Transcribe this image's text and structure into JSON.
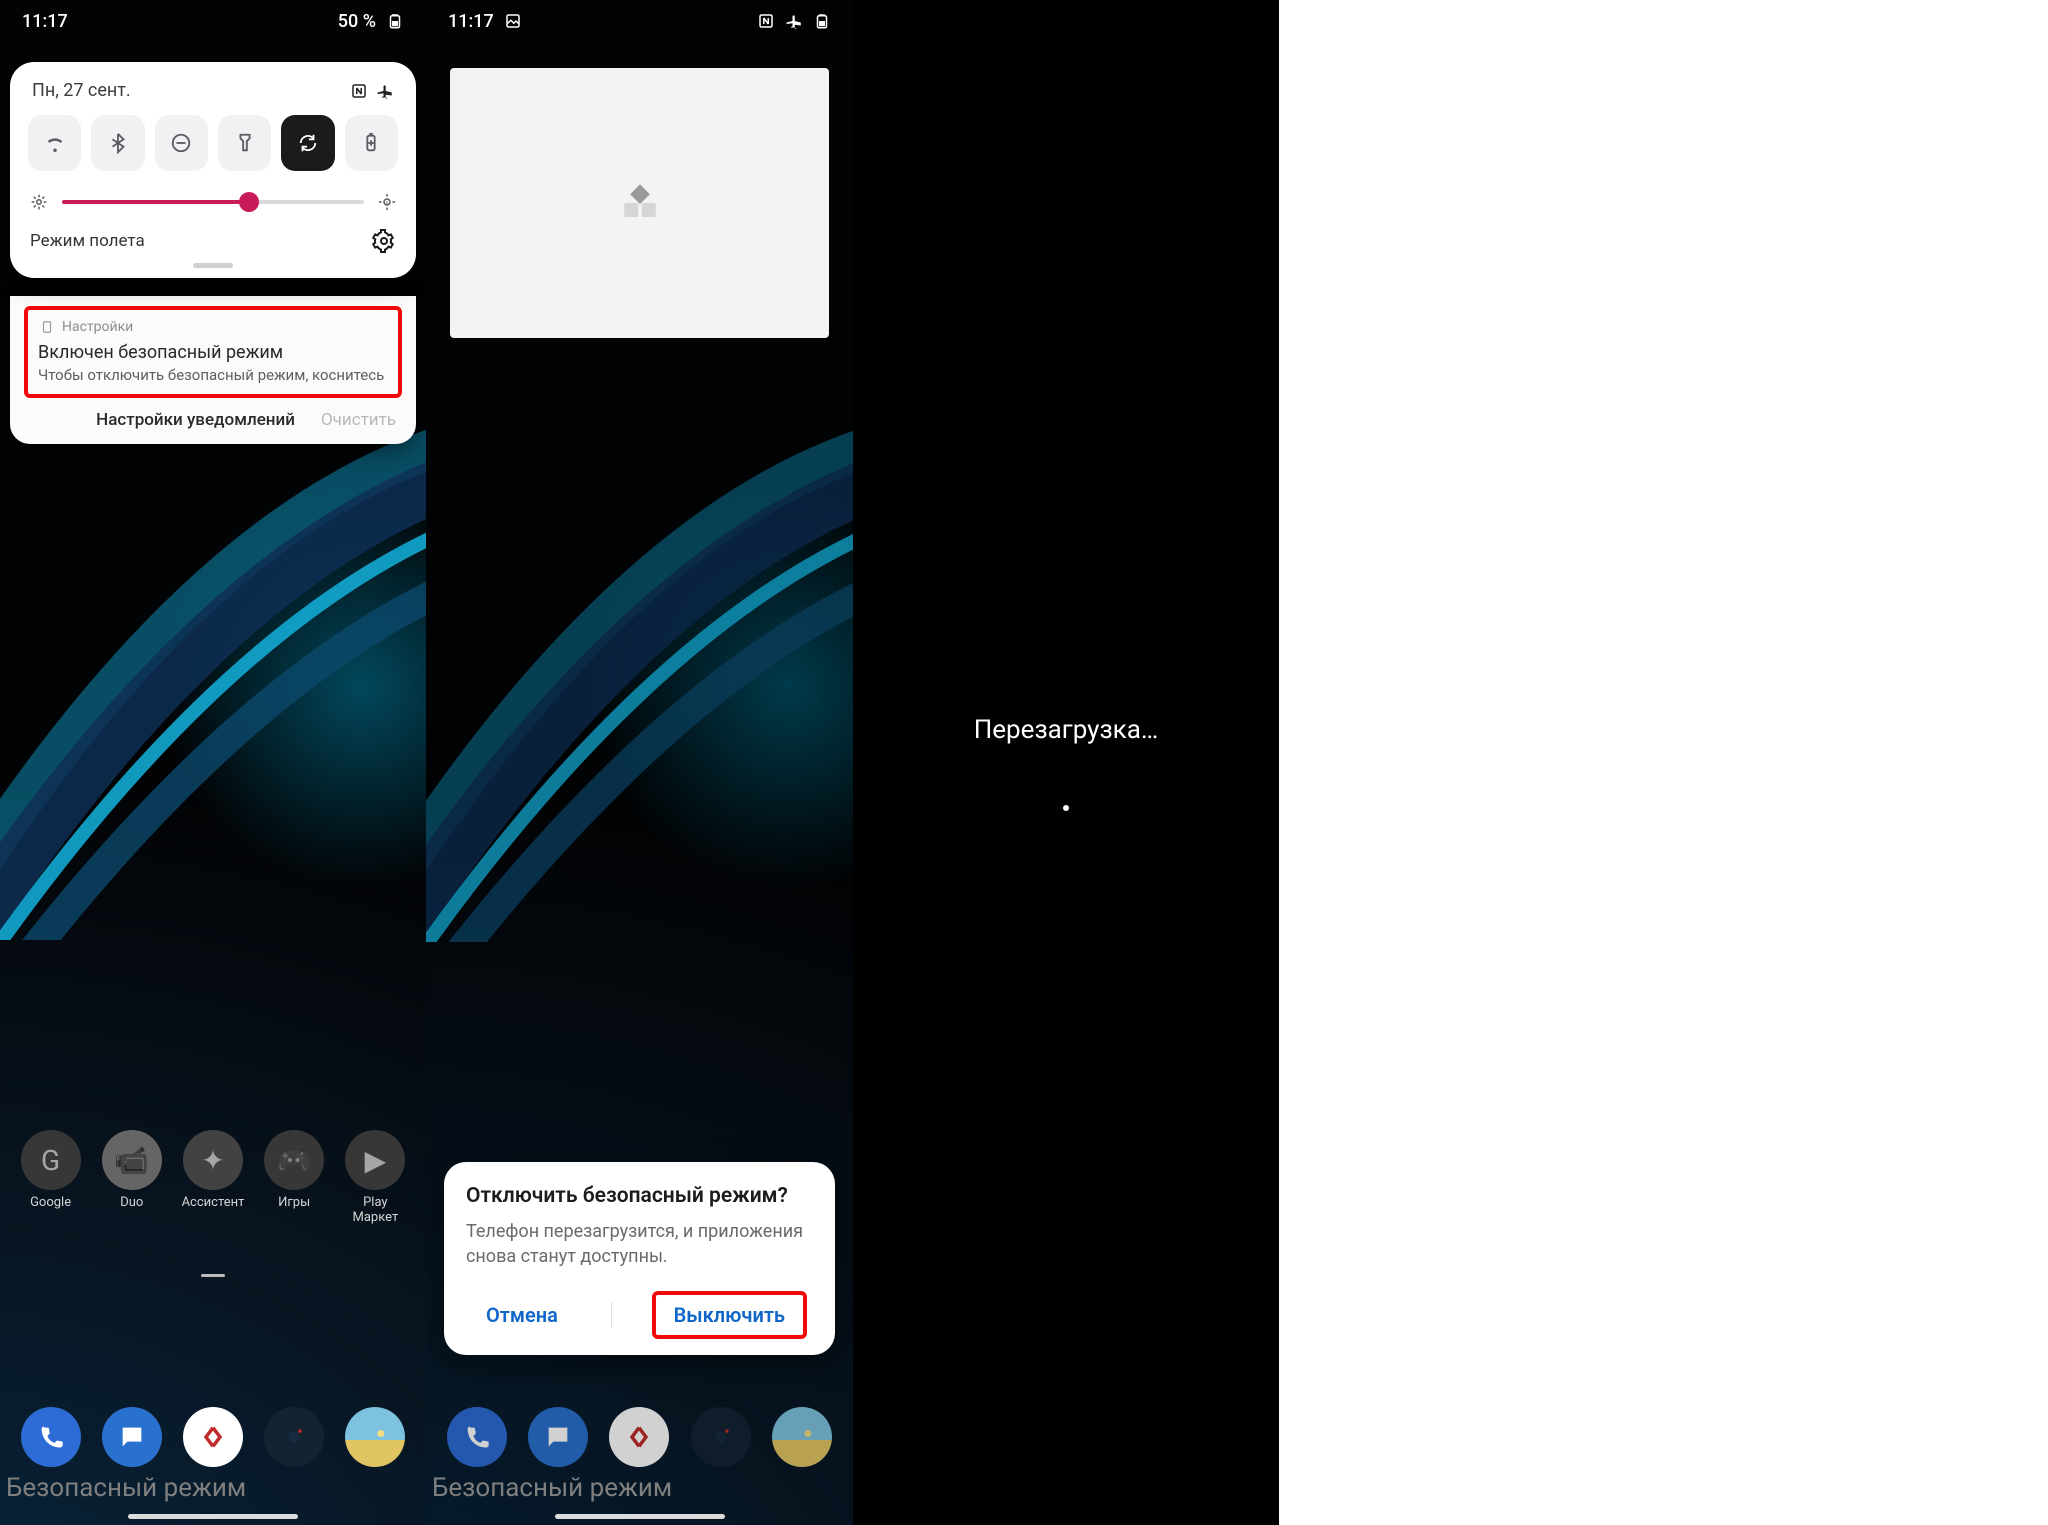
{
  "status": {
    "time": "11:17",
    "battery_pct": "50 %",
    "nfc": "NFC",
    "airplane": "airplane"
  },
  "p1": {
    "date": "Пн, 27 сент.",
    "mode_label": "Режим полета",
    "notif": {
      "app": "Настройки",
      "title": "Включен безопасный режим",
      "body": "Чтобы отключить безопасный режим, коснитесь зде..",
      "action_settings": "Настройки уведомлений",
      "action_clear": "Очистить"
    },
    "apps": {
      "upper": [
        "Google",
        "Duo",
        "Ассистент",
        "Игры",
        "Play Маркет"
      ]
    }
  },
  "p2": {
    "dialog": {
      "title": "Отключить безопасный режим?",
      "body": "Телефон перезагрузится, и приложения снова станут доступны.",
      "cancel": "Отмена",
      "confirm": "Выключить"
    }
  },
  "p3": {
    "reboot": "Перезагрузка…"
  },
  "safe_mode_label": "Безопасный режим",
  "colors": {
    "accent_pink": "#c81b5a",
    "link_blue": "#1167c8",
    "highlight_red": "#ef0a0a"
  },
  "dock_colors": {
    "phone": "#1f6df2",
    "messages": "#1a73e8",
    "browser": "#ffffff",
    "camera": "#0f2436",
    "contacts": "#2aa8d8"
  }
}
